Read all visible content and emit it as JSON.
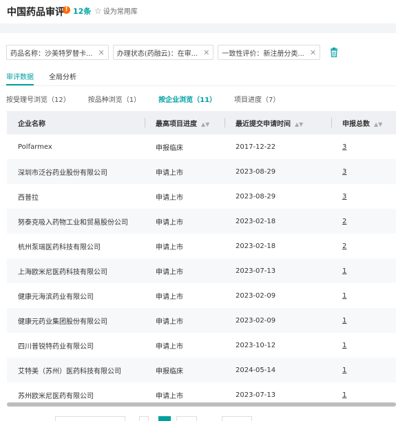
{
  "header": {
    "title": "中国药品审评",
    "info_icon": "!",
    "count": "12条",
    "favorite_label": "设为常用库"
  },
  "filters": [
    {
      "label": "药品名称：沙美特罗替卡..."
    },
    {
      "label": "办理状态(药融云)：在审..."
    },
    {
      "label": "一致性评价：新注册分类..."
    }
  ],
  "subnav": {
    "items": [
      "审评数据",
      "全局分析"
    ]
  },
  "tabs": [
    {
      "label": "按受理号浏览（12）"
    },
    {
      "label": "按品种浏览（1）"
    },
    {
      "label": "按企业浏览（11）"
    },
    {
      "label": "项目进度（7）"
    }
  ],
  "table": {
    "columns": [
      "企业名称",
      "最高项目进度",
      "最近提交申请时间",
      "申报总数"
    ],
    "rows": [
      {
        "company": "Polfarmex",
        "progress": "申报临床",
        "date": "2017-12-22",
        "total": "3"
      },
      {
        "company": "深圳市泛谷药业股份有限公司",
        "progress": "申请上市",
        "date": "2023-08-29",
        "total": "3"
      },
      {
        "company": "西普拉",
        "progress": "申请上市",
        "date": "2023-08-29",
        "total": "3"
      },
      {
        "company": "努泰克吸入药物工业和贸易股份公司",
        "progress": "申请上市",
        "date": "2023-02-18",
        "total": "2"
      },
      {
        "company": "杭州泵瑞医药科技有限公司",
        "progress": "申请上市",
        "date": "2023-02-18",
        "total": "2"
      },
      {
        "company": "上海欧米尼医药科技有限公司",
        "progress": "申请上市",
        "date": "2023-07-13",
        "total": "1"
      },
      {
        "company": "健康元海滨药业有限公司",
        "progress": "申请上市",
        "date": "2023-02-09",
        "total": "1"
      },
      {
        "company": "健康元药业集团股份有限公司",
        "progress": "申请上市",
        "date": "2023-02-09",
        "total": "1"
      },
      {
        "company": "四川普锐特药业有限公司",
        "progress": "申请上市",
        "date": "2023-10-12",
        "total": "1"
      },
      {
        "company": "艾特美（苏州）医药科技有限公司",
        "progress": "申报临床",
        "date": "2024-05-14",
        "total": "1"
      },
      {
        "company": "苏州欧米尼医药有限公司",
        "progress": "申请上市",
        "date": "2023-07-13",
        "total": "1"
      }
    ]
  },
  "colors": {
    "accent": "#00a0a0",
    "warning": "#ff6a00"
  }
}
